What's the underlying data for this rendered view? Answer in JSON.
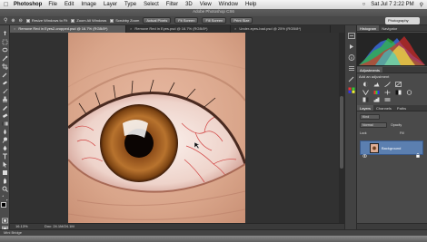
{
  "menubar": {
    "app_name": "Photoshop",
    "items": [
      "File",
      "Edit",
      "Image",
      "Layer",
      "Type",
      "Select",
      "Filter",
      "3D",
      "View",
      "Window",
      "Help"
    ],
    "clock": "Sat Jul 7  2:22 PM"
  },
  "window": {
    "title": "Adobe Photoshop CS6"
  },
  "options_bar": {
    "checkbox_resize": "Resize Windows to Fit",
    "checkbox_zoom_all": "Zoom All Windows",
    "checkbox_scrubby": "Scrubby Zoom",
    "btn_actual": "Actual Pixels",
    "btn_fit": "Fit Screen",
    "btn_fill": "Fill Screen",
    "btn_print": "Print Size",
    "workspace": "Photography"
  },
  "tabs": [
    {
      "label": "Remove Red in Eyes2-cropped.psd @ 16.7% (RGB/8*)",
      "active": true
    },
    {
      "label": "Remove Red in Eyes.psd @ 16.7% (RGB/8*)",
      "active": false
    },
    {
      "label": "Under-eyes-bad.psd @ 25% (RGB/8*)",
      "active": false
    }
  ],
  "status": {
    "zoom": "16.13%",
    "doc": "Doc: 24.1M/24.1M"
  },
  "mini_bridge": "Mini Bridge",
  "panels": {
    "histogram_tabs": [
      "Histogram",
      "Navigator"
    ],
    "adjustments_tab": "Adjustments",
    "adjustments_hint": "Add an adjustment",
    "layers_tabs": [
      "Layers",
      "Channels",
      "Paths"
    ],
    "kind_label": "Kind",
    "blend_mode": "Normal",
    "opacity_label": "Opacity",
    "fill_label": "Fill",
    "lock_label": "Lock",
    "layer_name": "Background"
  },
  "colors": {
    "accent": "#5b7fb0",
    "panel": "#4a4a4a",
    "canvas": "#313131"
  }
}
